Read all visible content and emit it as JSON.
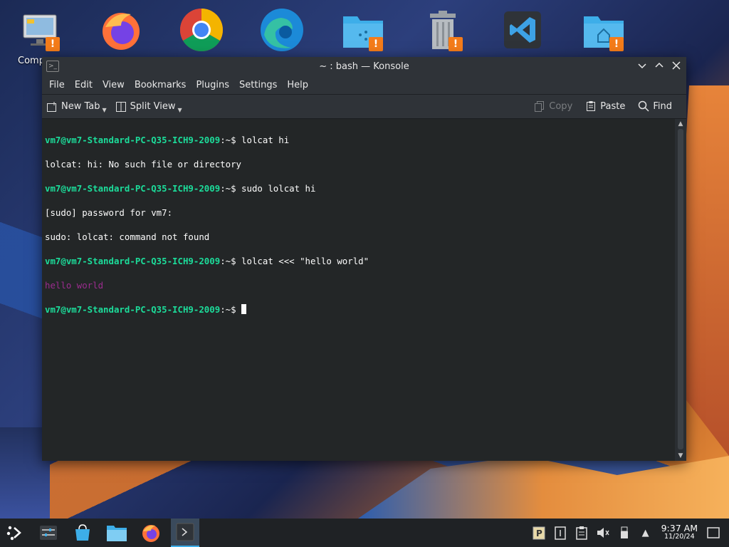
{
  "desktop": {
    "icons": [
      {
        "name": "computer",
        "label": "Comp",
        "badge": "!"
      },
      {
        "name": "firefox"
      },
      {
        "name": "chrome"
      },
      {
        "name": "edge"
      },
      {
        "name": "shared-folder",
        "badge": "!"
      },
      {
        "name": "trash",
        "badge": "!"
      },
      {
        "name": "vscode"
      },
      {
        "name": "home-folder",
        "badge": "!"
      }
    ]
  },
  "window": {
    "title": "~ : bash — Konsole",
    "menu": [
      "File",
      "Edit",
      "View",
      "Bookmarks",
      "Plugins",
      "Settings",
      "Help"
    ],
    "toolbar": {
      "new_tab": "New Tab",
      "split_view": "Split View",
      "copy": "Copy",
      "paste": "Paste",
      "find": "Find"
    }
  },
  "terminal": {
    "prompt_user": "vm7@vm7-Standard-PC-Q35-ICH9-2009",
    "prompt_suffix": ":~$",
    "lines": [
      {
        "cmd": " lolcat hi"
      },
      {
        "out": "lolcat: hi: No such file or directory"
      },
      {
        "cmd": " sudo lolcat hi"
      },
      {
        "out": "[sudo] password for vm7:"
      },
      {
        "out": "sudo: lolcat: command not found"
      },
      {
        "cmd": " lolcat <<< \"hello world\""
      },
      {
        "lolcat": "hello world"
      },
      {
        "cmd": " "
      }
    ]
  },
  "taskbar": {
    "clock_time": "9:37 AM",
    "clock_date": "11/20/24"
  },
  "colors": {
    "prompt": "#1cdc9a",
    "lolcat": "#9b2c8f",
    "accent": "#3daee9",
    "badge": "#f47c1a"
  }
}
